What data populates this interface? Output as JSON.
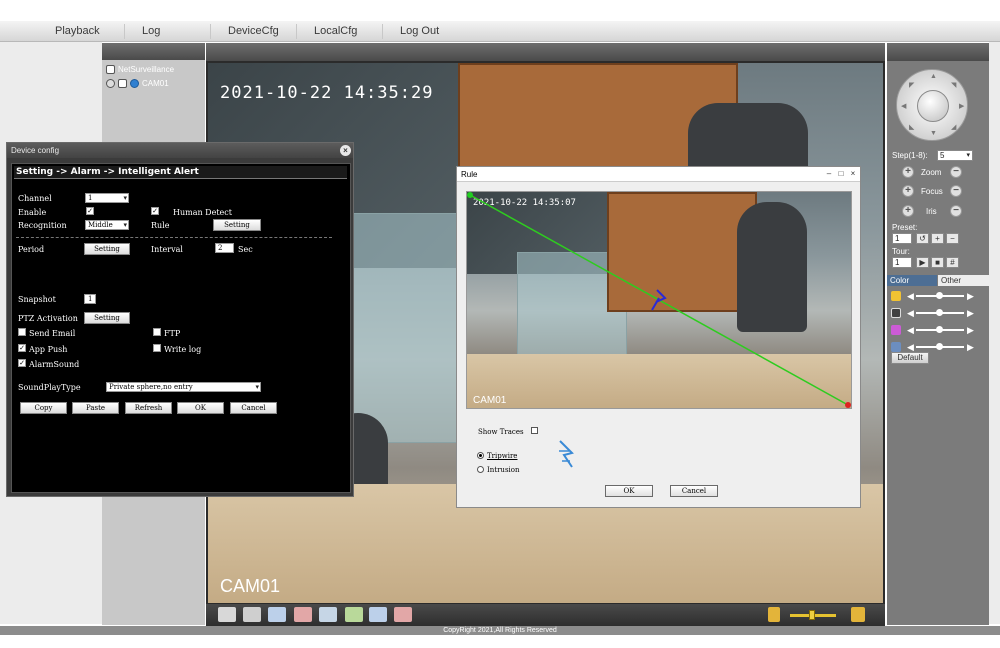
{
  "nav": {
    "items": [
      "Playback",
      "Log",
      "DeviceCfg",
      "LocalCfg",
      "Log Out"
    ]
  },
  "tree": {
    "root_label": "NetSurveillance",
    "camera_label": "CAM01"
  },
  "video": {
    "timestamp": "2021-10-22 14:35:29",
    "channel_overlay": "CAM01"
  },
  "ptz": {
    "step_label": "Step(1-8):",
    "step_value": "5",
    "zoom_label": "Zoom",
    "focus_label": "Focus",
    "iris_label": "Iris",
    "preset_label": "Preset:",
    "preset_value": "1",
    "tour_label": "Tour:",
    "tour_value": "1",
    "tabs": [
      "Color",
      "Other"
    ],
    "default_button": "Default"
  },
  "footer": {
    "copyright": "CopyRight 2021,All Rights Reserved"
  },
  "device_config": {
    "title": "Device config",
    "close_icon": "close-icon",
    "breadcrumb": "Setting -> Alarm -> Intelligent Alert",
    "channel_label": "Channel",
    "channel_value": "1",
    "enable_label": "Enable",
    "human_detect_label": "Human Detect",
    "recognition_label": "Recognition",
    "recognition_value": "Middle",
    "rule_label": "Rule",
    "rule_setting_button": "Setting",
    "period_label": "Period",
    "period_setting_button": "Setting",
    "interval_label": "Interval",
    "interval_value": "2",
    "interval_unit": "Sec",
    "snapshot_label": "Snapshot",
    "snapshot_value": "1",
    "ptz_activation_label": "PTZ Activation",
    "ptz_setting_button": "Setting",
    "send_email_label": "Send Email",
    "ftp_label": "FTP",
    "app_push_label": "App Push",
    "write_log_label": "Write log",
    "alarm_sound_label": "AlarmSound",
    "sound_play_type_label": "SoundPlayType",
    "sound_play_type_value": "Private sphere,no entry",
    "buttons": {
      "copy": "Copy",
      "paste": "Paste",
      "refresh": "Refresh",
      "ok": "OK",
      "cancel": "Cancel"
    }
  },
  "rule_dialog": {
    "title": "Rule",
    "video_timestamp": "2021-10-22 14:35:07",
    "video_channel": "CAM01",
    "show_traces_label": "Show Traces",
    "tripwire_label": "Tripwire",
    "intrusion_label": "Intrusion",
    "ok_button": "OK",
    "cancel_button": "Cancel"
  },
  "colors": {
    "tripwire_line": "#2ecc1f",
    "tripwire_start": "#22cc22",
    "tripwire_end": "#dd2222",
    "direction_arrow": "#2a2ad8",
    "panel_header": "#555555"
  }
}
